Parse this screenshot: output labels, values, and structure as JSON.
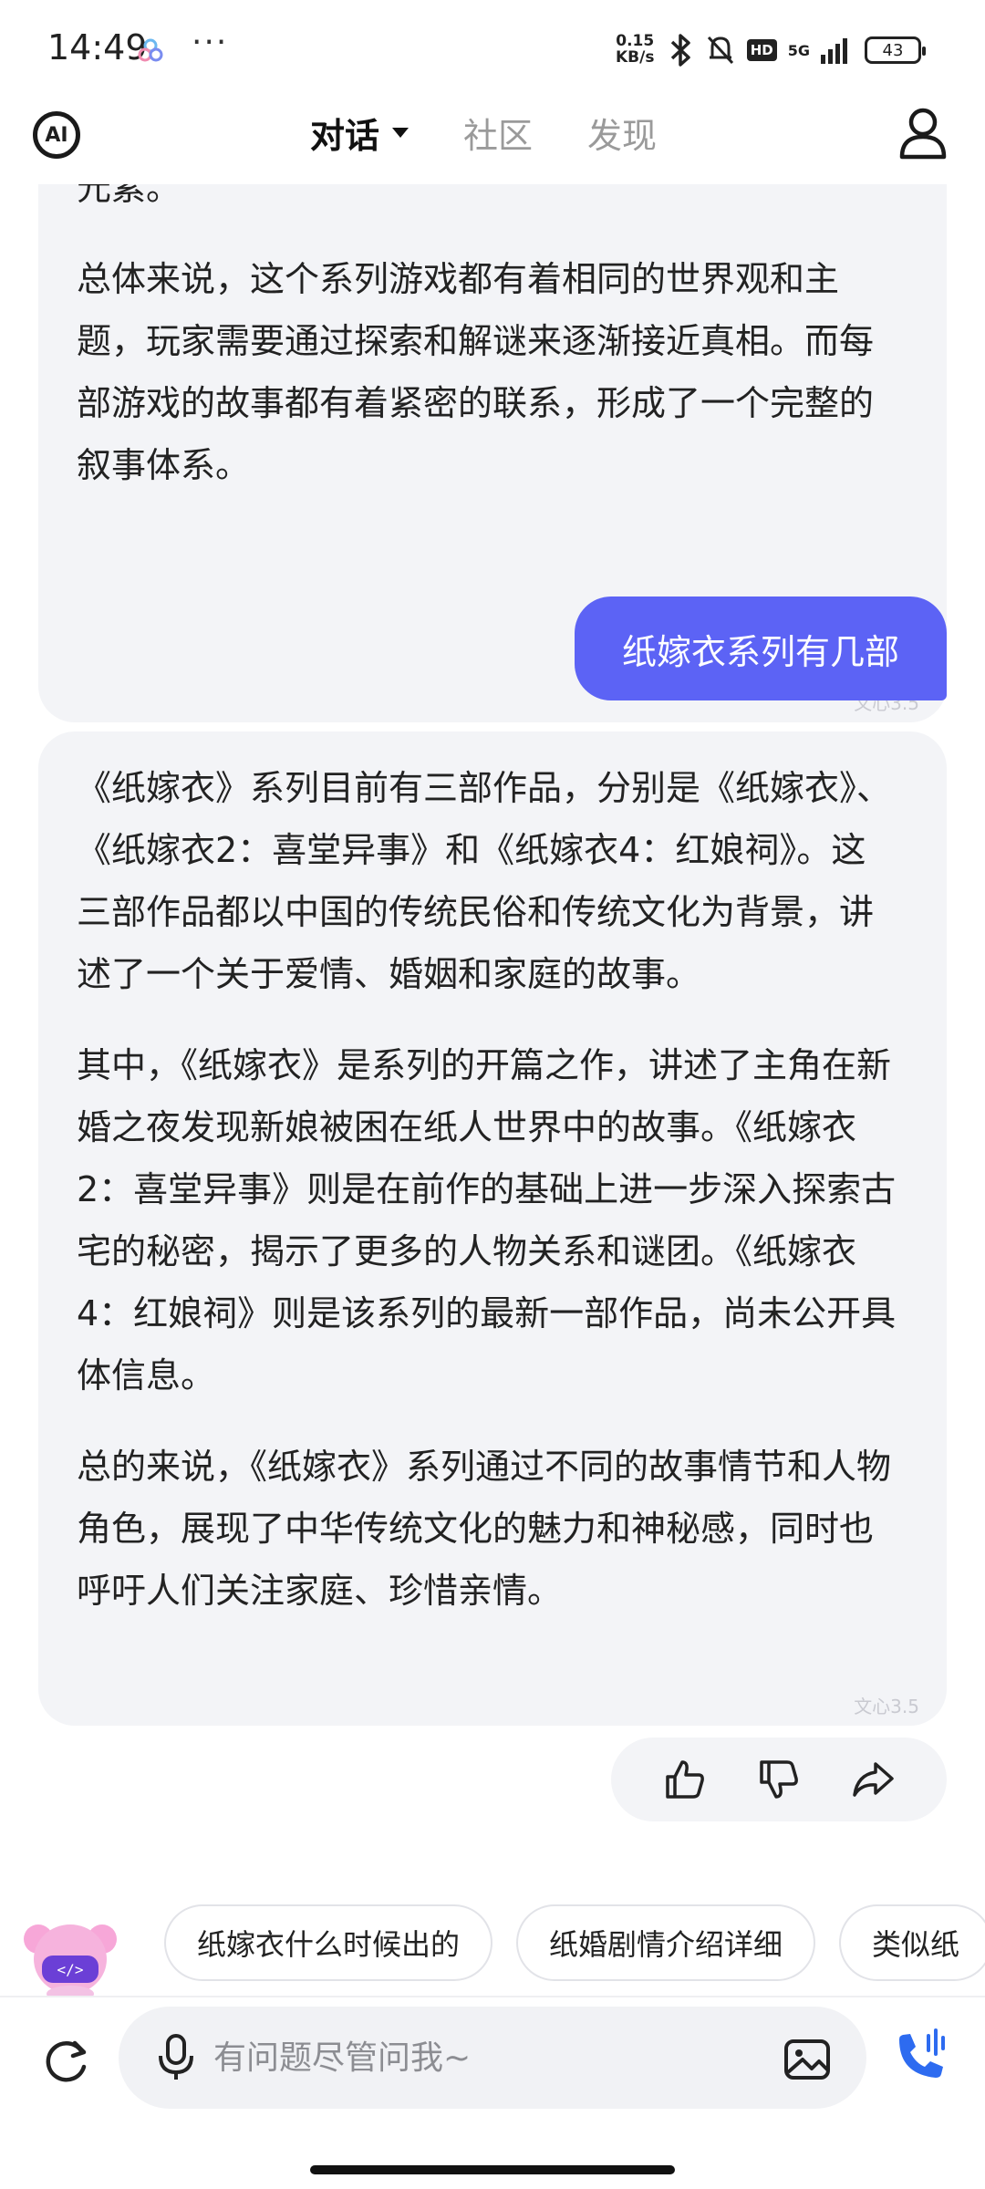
{
  "status_bar": {
    "time": "14:49",
    "more": "···",
    "net_speed_value": "0.15",
    "net_speed_unit": "KB/s",
    "network": "5G",
    "hd": "HD",
    "battery": "43"
  },
  "nav": {
    "tabs": [
      {
        "label": "对话",
        "active": true
      },
      {
        "label": "社区",
        "active": false
      },
      {
        "label": "发现",
        "active": false
      }
    ],
    "logo_text": "AI"
  },
  "chat": {
    "bot_message_1": {
      "paragraphs": [
        "元素。",
        "总体来说，这个系列游戏都有着相同的世界观和主题，玩家需要通过探索和解谜来逐渐接近真相。而每部游戏的故事都有着紧密的联系，形成了一个完整的叙事体系。"
      ],
      "watermark": "文心3.5"
    },
    "user_message": "纸嫁衣系列有几部",
    "bot_message_2": {
      "paragraphs": [
        "《纸嫁衣》系列目前有三部作品，分别是《纸嫁衣》、《纸嫁衣2：喜堂异事》和《纸嫁衣4：红娘祠》。这三部作品都以中国的传统民俗和传统文化为背景，讲述了一个关于爱情、婚姻和家庭的故事。",
        "其中，《纸嫁衣》是系列的开篇之作，讲述了主角在新婚之夜发现新娘被困在纸人世界中的故事。《纸嫁衣2：喜堂异事》则是在前作的基础上进一步深入探索古宅的秘密，揭示了更多的人物关系和谜团。《纸嫁衣4：红娘祠》则是该系列的最新一部作品，尚未公开具体信息。",
        "总的来说，《纸嫁衣》系列通过不同的故事情节和人物角色，展现了中华传统文化的魅力和神秘感，同时也呼吁人们关注家庭、珍惜亲情。"
      ],
      "watermark": "文心3.5"
    }
  },
  "suggestions": [
    "纸嫁衣什么时候出的",
    "纸婚剧情介绍详细",
    "类似纸"
  ],
  "input": {
    "placeholder": "有问题尽管问我~"
  },
  "colors": {
    "accent": "#5c63f5",
    "bubble_bg": "#f3f4f7",
    "call_blue": "#2d6bf0"
  },
  "icons": {
    "like": "thumbs-up-icon",
    "dislike": "thumbs-down-icon",
    "share": "share-icon",
    "refresh": "refresh-icon",
    "mic": "mic-icon",
    "image": "image-icon",
    "call": "phone-call-icon",
    "profile": "user-icon"
  }
}
